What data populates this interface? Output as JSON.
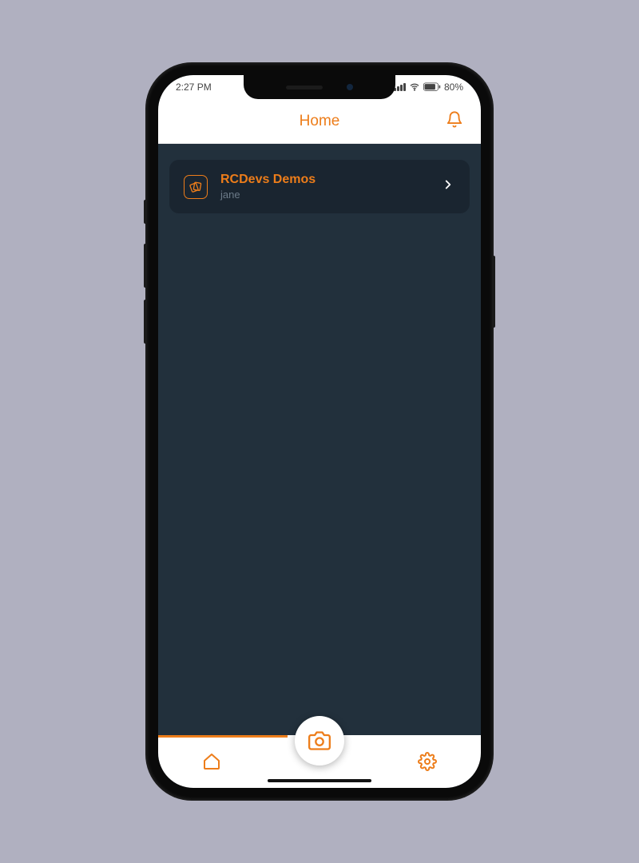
{
  "status_bar": {
    "time": "2:27 PM",
    "battery_text": "80%"
  },
  "header": {
    "title": "Home"
  },
  "accounts": [
    {
      "title": "RCDevs Demos",
      "subtitle": "jane"
    }
  ],
  "colors": {
    "accent": "#ed7d1a",
    "app_bg": "#22303c",
    "card_bg": "#1a2530"
  }
}
